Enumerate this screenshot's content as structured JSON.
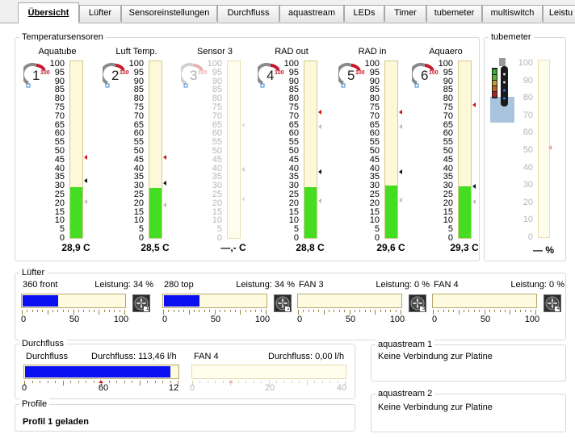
{
  "tabs": [
    "Übersicht",
    "Lüfter",
    "Sensoreinstellungen",
    "Durchfluss",
    "aquastream",
    "LEDs",
    "Timer",
    "tubemeter",
    "multiswitch",
    "Leistu"
  ],
  "temp_group": {
    "title": "Temperatursensoren",
    "scale": [
      "100",
      "95",
      "90",
      "85",
      "80",
      "75",
      "70",
      "65",
      "60",
      "55",
      "50",
      "45",
      "40",
      "35",
      "30",
      "25",
      "20",
      "15",
      "10",
      "5",
      "0"
    ],
    "sensors": [
      {
        "name": "Aquatube",
        "num": "1",
        "gauge_max": "100",
        "value": "28,9 C",
        "level": 0.289,
        "active": true
      },
      {
        "name": "Luft Temp.",
        "num": "2",
        "gauge_max": "100",
        "value": "28,5 C",
        "level": 0.285,
        "active": true
      },
      {
        "name": "Sensor 3",
        "num": "3",
        "gauge_max": "100",
        "value": "—,- C",
        "level": 0,
        "active": false
      },
      {
        "name": "RAD out",
        "num": "4",
        "gauge_max": "100",
        "value": "28,8 C",
        "level": 0.288,
        "active": true
      },
      {
        "name": "RAD in",
        "num": "5",
        "gauge_max": "100",
        "value": "29,6 C",
        "level": 0.296,
        "active": true
      },
      {
        "name": "Aquaero",
        "num": "6",
        "gauge_max": "100",
        "value": "29,3 C",
        "level": 0.293,
        "active": true
      }
    ]
  },
  "tubemeter": {
    "title": "tubemeter",
    "value": "— %"
  },
  "fans": {
    "title": "Lüfter",
    "items": [
      {
        "name": "360 front",
        "power": "Leistung: 34 %",
        "level": 0.34,
        "num": "1",
        "ticks": [
          "0",
          "50",
          "100"
        ]
      },
      {
        "name": "280 top",
        "power": "Leistung: 34 %",
        "level": 0.34,
        "num": "2",
        "ticks": [
          "0",
          "50",
          "100"
        ]
      },
      {
        "name": "FAN 3",
        "power": "Leistung: 0 %",
        "level": 0,
        "num": "3",
        "ticks": [
          "0",
          "50",
          "100"
        ]
      },
      {
        "name": "FAN 4",
        "power": "Leistung: 0 %",
        "level": 0,
        "num": "4",
        "ticks": [
          "0",
          "50",
          "100"
        ]
      }
    ]
  },
  "flow": {
    "title": "Durchfluss",
    "main": {
      "name": "Durchfluss",
      "value": "Durchfluss: 113,46 l/h",
      "level": 0.945,
      "ticks": [
        "0",
        "60",
        "12"
      ]
    },
    "fan4": {
      "name": "FAN 4",
      "value": "Durchfluss: 0,00 l/h",
      "ticks": [
        "0",
        "20",
        "40"
      ]
    }
  },
  "aquastream1": {
    "title": "aquastream 1",
    "status": "Keine Verbindung zur Platine"
  },
  "aquastream2": {
    "title": "aquastream 2",
    "status": "Keine Verbindung zur Platine"
  },
  "profile": {
    "title": "Profile",
    "status": "Profil 1 geladen"
  }
}
